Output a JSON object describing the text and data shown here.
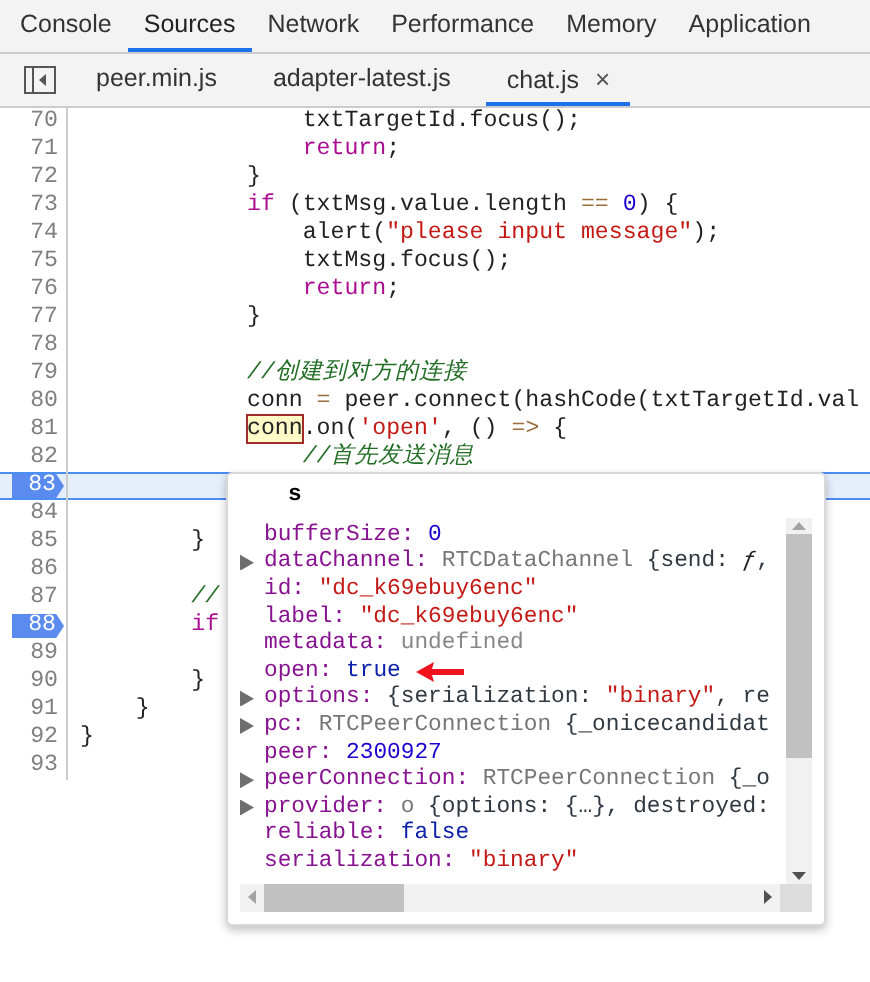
{
  "panel_tabs": [
    {
      "label": "Console",
      "selected": false
    },
    {
      "label": "Sources",
      "selected": true
    },
    {
      "label": "Network",
      "selected": false
    },
    {
      "label": "Performance",
      "selected": false
    },
    {
      "label": "Memory",
      "selected": false
    },
    {
      "label": "Application",
      "selected": false
    }
  ],
  "file_tabs": [
    {
      "label": "peer.min.js",
      "selected": false
    },
    {
      "label": "adapter-latest.js",
      "selected": false
    },
    {
      "label": "chat.js",
      "selected": true,
      "close": "×"
    }
  ],
  "code_lines": [
    {
      "number": "70",
      "breakpoint": false,
      "current": false,
      "tokens": [
        {
          "kind": "plain",
          "text": "                txtTargetId.focus();"
        }
      ]
    },
    {
      "number": "71",
      "breakpoint": false,
      "current": false,
      "tokens": [
        {
          "kind": "keyword",
          "text": "                return"
        },
        {
          "kind": "plain",
          "text": ";"
        }
      ]
    },
    {
      "number": "72",
      "breakpoint": false,
      "current": false,
      "tokens": [
        {
          "kind": "plain",
          "text": "            }"
        }
      ]
    },
    {
      "number": "73",
      "breakpoint": false,
      "current": false,
      "tokens": [
        {
          "kind": "keyword",
          "text": "            if"
        },
        {
          "kind": "plain",
          "text": " (txtMsg.value.length "
        },
        {
          "kind": "operator",
          "text": "== "
        },
        {
          "kind": "number",
          "text": "0"
        },
        {
          "kind": "plain",
          "text": ") {"
        }
      ]
    },
    {
      "number": "74",
      "breakpoint": false,
      "current": false,
      "tokens": [
        {
          "kind": "plain",
          "text": "                alert("
        },
        {
          "kind": "string",
          "text": "\"please input message\""
        },
        {
          "kind": "plain",
          "text": ");"
        }
      ]
    },
    {
      "number": "75",
      "breakpoint": false,
      "current": false,
      "tokens": [
        {
          "kind": "plain",
          "text": "                txtMsg.focus();"
        }
      ]
    },
    {
      "number": "76",
      "breakpoint": false,
      "current": false,
      "tokens": [
        {
          "kind": "keyword",
          "text": "                return"
        },
        {
          "kind": "plain",
          "text": ";"
        }
      ]
    },
    {
      "number": "77",
      "breakpoint": false,
      "current": false,
      "tokens": [
        {
          "kind": "plain",
          "text": "            }"
        }
      ]
    },
    {
      "number": "78",
      "breakpoint": false,
      "current": false
    },
    {
      "number": "79",
      "breakpoint": false,
      "current": false,
      "tokens": [
        {
          "kind": "comment",
          "text": "            //创建到对方的连接"
        }
      ]
    },
    {
      "number": "80",
      "breakpoint": false,
      "current": false,
      "tokens": [
        {
          "kind": "plain",
          "text": "            conn "
        },
        {
          "kind": "operator",
          "text": "="
        },
        {
          "kind": "plain",
          "text": " peer.connect(hashCode(txtTargetId.val"
        }
      ]
    },
    {
      "number": "81",
      "breakpoint": false,
      "current": false,
      "tokens": [
        {
          "kind": "hovered",
          "text": "conn"
        },
        {
          "kind": "plain",
          "text": ".on("
        },
        {
          "kind": "string",
          "text": "'open'"
        },
        {
          "kind": "plain",
          "text": ", () "
        },
        {
          "kind": "operator",
          "text": "=>"
        },
        {
          "kind": "plain",
          "text": " {"
        }
      ]
    },
    {
      "number": "82",
      "breakpoint": false,
      "current": false,
      "tokens": [
        {
          "kind": "comment",
          "text": "                //首先发送消息"
        }
      ]
    },
    {
      "number": "83",
      "breakpoint": true,
      "current": true
    },
    {
      "number": "84",
      "breakpoint": false,
      "current": false
    },
    {
      "number": "85",
      "breakpoint": false,
      "current": false,
      "tokens": [
        {
          "kind": "plain",
          "text": "        }"
        }
      ]
    },
    {
      "number": "86",
      "breakpoint": false,
      "current": false
    },
    {
      "number": "87",
      "breakpoint": false,
      "current": false,
      "tokens": [
        {
          "kind": "comment",
          "text": "        //"
        }
      ]
    },
    {
      "number": "88",
      "breakpoint": true,
      "current": false,
      "tokens": [
        {
          "kind": "keyword",
          "text": "        if"
        }
      ]
    },
    {
      "number": "89",
      "breakpoint": false,
      "current": false
    },
    {
      "number": "90",
      "breakpoint": false,
      "current": false,
      "tokens": [
        {
          "kind": "plain",
          "text": "        }"
        }
      ]
    },
    {
      "number": "91",
      "breakpoint": false,
      "current": false,
      "tokens": [
        {
          "kind": "plain",
          "text": "    }"
        }
      ]
    },
    {
      "number": "92",
      "breakpoint": false,
      "current": false,
      "tokens": [
        {
          "kind": "plain",
          "text": "}"
        }
      ]
    },
    {
      "number": "93",
      "breakpoint": false,
      "current": false
    }
  ],
  "popover": {
    "title": "s",
    "properties": [
      {
        "key": "bufferSize:",
        "expandable": false,
        "pointed": false,
        "value": [
          {
            "kind": "number",
            "text": " 0"
          }
        ]
      },
      {
        "key": "dataChannel:",
        "expandable": true,
        "pointed": false,
        "value": [
          {
            "kind": "class",
            "text": " RTCDataChannel "
          },
          {
            "kind": "plain",
            "text": "{send: "
          },
          {
            "kind": "function",
            "text": "ƒ"
          },
          {
            "kind": "plain",
            "text": ","
          }
        ]
      },
      {
        "key": "id:",
        "expandable": false,
        "pointed": false,
        "value": [
          {
            "kind": "string",
            "text": " \"dc_k69ebuy6enc\""
          }
        ]
      },
      {
        "key": "label:",
        "expandable": false,
        "pointed": false,
        "value": [
          {
            "kind": "string",
            "text": " \"dc_k69ebuy6enc\""
          }
        ]
      },
      {
        "key": "metadata:",
        "expandable": false,
        "pointed": false,
        "value": [
          {
            "kind": "undefined",
            "text": " undefined"
          }
        ]
      },
      {
        "key": "open:",
        "expandable": false,
        "pointed": true,
        "value": [
          {
            "kind": "boolean",
            "text": " true"
          }
        ]
      },
      {
        "key": "options:",
        "expandable": true,
        "pointed": false,
        "value": [
          {
            "kind": "plain",
            "text": " {serialization: "
          },
          {
            "kind": "string",
            "text": "\"binary\""
          },
          {
            "kind": "plain",
            "text": ", re"
          }
        ]
      },
      {
        "key": "pc:",
        "expandable": true,
        "pointed": false,
        "value": [
          {
            "kind": "class",
            "text": " RTCPeerConnection "
          },
          {
            "kind": "plain",
            "text": "{_onicecandidat"
          }
        ]
      },
      {
        "key": "peer:",
        "expandable": false,
        "pointed": false,
        "value": [
          {
            "kind": "number",
            "text": " 2300927"
          }
        ]
      },
      {
        "key": "peerConnection:",
        "expandable": true,
        "pointed": false,
        "value": [
          {
            "kind": "class",
            "text": " RTCPeerConnection "
          },
          {
            "kind": "plain",
            "text": "{_o"
          }
        ]
      },
      {
        "key": "provider:",
        "expandable": true,
        "pointed": false,
        "value": [
          {
            "kind": "class",
            "text": " o "
          },
          {
            "kind": "plain",
            "text": "{options: {…}, destroyed:"
          }
        ]
      },
      {
        "key": "reliable:",
        "expandable": false,
        "pointed": false,
        "value": [
          {
            "kind": "boolean",
            "text": " false"
          }
        ]
      },
      {
        "key": "serialization:",
        "expandable": false,
        "pointed": false,
        "value": [
          {
            "kind": "string",
            "text": " \"binary\""
          }
        ]
      }
    ]
  }
}
